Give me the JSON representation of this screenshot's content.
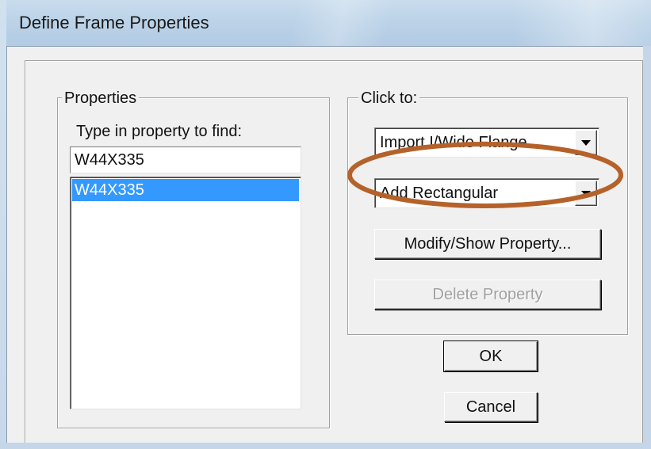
{
  "window": {
    "title": "Define Frame Properties"
  },
  "properties_group": {
    "label": "Properties",
    "find_label": "Type in property to find:",
    "find_value": "W44X335",
    "list_items": [
      {
        "label": "W44X335",
        "selected": true
      }
    ]
  },
  "click_to_group": {
    "label": "Click to:",
    "import_combo": {
      "value": "Import I/Wide Flange"
    },
    "add_combo": {
      "value": "Add Rectangular"
    },
    "modify_button": "Modify/Show Property...",
    "delete_button": "Delete Property"
  },
  "buttons": {
    "ok": "OK",
    "cancel": "Cancel"
  },
  "colors": {
    "selection": "#3399ff",
    "annotation_ellipse": "#b5622a"
  },
  "icons": {
    "combo_arrow": "chevron-down-icon"
  }
}
